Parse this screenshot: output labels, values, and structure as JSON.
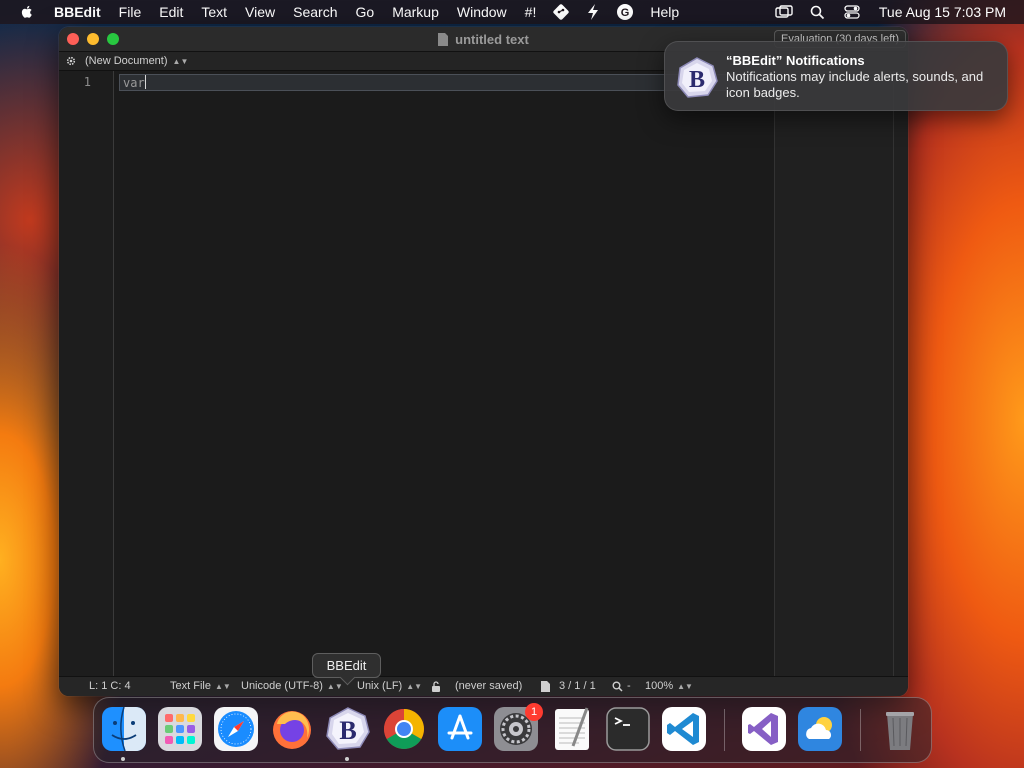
{
  "menubar": {
    "app_name": "BBEdit",
    "items": [
      "File",
      "Edit",
      "Text",
      "View",
      "Search",
      "Go",
      "Markup",
      "Window",
      "#!"
    ],
    "help": "Help",
    "clock": "Tue Aug 15  7:03 PM",
    "status_icons": [
      "screen-mirroring-icon",
      "spotlight-search-icon",
      "control-center-icon"
    ],
    "extra_menu_icons": [
      "git-icon",
      "lightning-icon",
      "grammarly-icon"
    ]
  },
  "window": {
    "title": "untitled text",
    "evaluation": "Evaluation (30 days left)",
    "navbar_label": "(New Document)",
    "line_number": "1",
    "code_text": "var",
    "status": {
      "position": "L: 1 C: 4",
      "language": "Text File",
      "encoding": "Unicode (UTF-8)",
      "line_endings": "Unix (LF)",
      "save_state": "(never saved)",
      "counts": "3 / 1 / 1",
      "zoom_sep": "-",
      "zoom": "100%"
    }
  },
  "notification": {
    "title": "“BBEdit” Notifications",
    "body": "Notifications may include alerts, sounds, and icon badges."
  },
  "dock": {
    "tooltip": "BBEdit",
    "apps": [
      "Finder",
      "Launchpad",
      "Safari",
      "Firefox",
      "BBEdit",
      "Google Chrome",
      "App Store",
      "System Settings",
      "TextEdit",
      "Terminal",
      "Visual Studio Code",
      "Visual Studio",
      "Weather",
      "Trash"
    ],
    "settings_badge": "1"
  },
  "colors": {
    "accent_close": "#fe5f57",
    "accent_minimize": "#febc2e",
    "accent_maximize": "#28c840",
    "badge": "#ff3b30"
  }
}
